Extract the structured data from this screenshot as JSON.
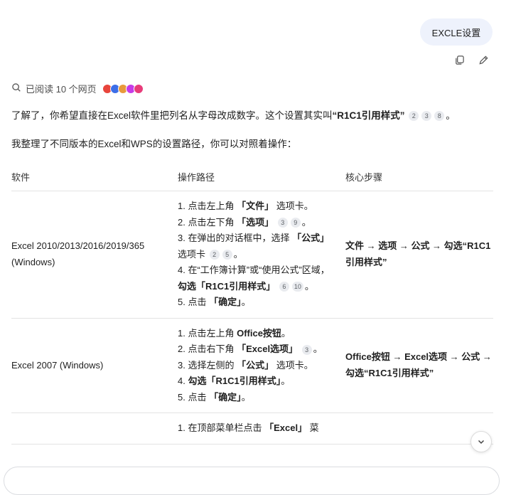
{
  "user_message": {
    "text": "EXCLE设置"
  },
  "message_actions": {
    "copy_icon": "copy-icon",
    "edit_icon": "edit-icon"
  },
  "read_status": {
    "text": "已阅读 10 个网页",
    "icon": "search-icon"
  },
  "favicon_colors": [
    "#e8453c",
    "#3c6ee8",
    "#e89a3c",
    "#c63ce8",
    "#e83c7a"
  ],
  "intro": {
    "line1_prefix": "了解了，你希望直接在Excel软件里把列名从字母改成数字。这个设置其实叫",
    "line1_highlight": "“R1C1引用样式”",
    "line1_cites": [
      "2",
      "3",
      "8"
    ],
    "line1_suffix": "。",
    "line2": "我整理了不同版本的Excel和WPS的设置路径，你可以对照着操作："
  },
  "table": {
    "headers": [
      "软件",
      "操作路径",
      "核心步骤"
    ],
    "rows": [
      {
        "software": "Excel 2010/2013/2016/2019/365 (Windows)",
        "steps": [
          {
            "pre": "1. 点击左上角 ",
            "bold": "「文件」",
            "post": " 选项卡。",
            "cites": []
          },
          {
            "pre": "2. 点击左下角 ",
            "bold": "「选项」",
            "post": " ",
            "cites": [
              "3",
              "9"
            ],
            "end": "。"
          },
          {
            "pre": "3. 在弹出的对话框中，选择 ",
            "bold": "「公式」",
            "post": " 选项卡 ",
            "cites": [
              "2",
              "5"
            ],
            "end": "。"
          },
          {
            "pre": "4. 在“工作簿计算”或“使用公式”区域，",
            "bold": "勾选「R1C1引用样式」",
            "post": " ",
            "cites": [
              "6",
              "10"
            ],
            "end": "。"
          },
          {
            "pre": "5. 点击 ",
            "bold": "「确定」",
            "post": "。",
            "cites": []
          }
        ],
        "core": "文件 → 选项 → 公式 → 勾选“R1C1引用样式”"
      },
      {
        "software": "Excel 2007 (Windows)",
        "steps": [
          {
            "pre": "1. 点击左上角 ",
            "bold": "Office按钮",
            "post": "。",
            "cites": []
          },
          {
            "pre": "2. 点击右下角 ",
            "bold": "「Excel选项」",
            "post": " ",
            "cites": [
              "3"
            ],
            "end": "。"
          },
          {
            "pre": "3. 选择左侧的 ",
            "bold": "「公式」",
            "post": " 选项卡。",
            "cites": []
          },
          {
            "pre": "4. ",
            "bold": "勾选「R1C1引用样式」",
            "post": "。",
            "cites": []
          },
          {
            "pre": "5. 点击 ",
            "bold": "「确定」",
            "post": "。",
            "cites": []
          }
        ],
        "core": "Office按钮 → Excel选项 → 公式 → 勾选“R1C1引用样式”"
      }
    ],
    "partial_row_step": {
      "pre": "1. 在顶部菜单栏点击 ",
      "bold": "「Excel」",
      "post": " 菜"
    }
  },
  "scroll_down_icon": "chevron-down-icon"
}
